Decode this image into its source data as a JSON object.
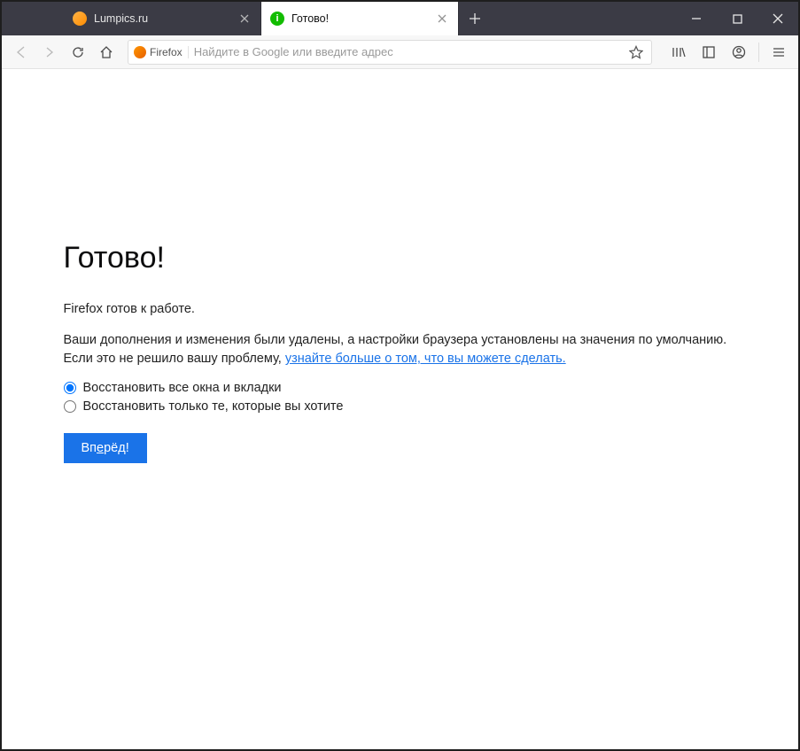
{
  "tabs": [
    {
      "title": "Lumpics.ru",
      "favicon": "lumpics-icon"
    },
    {
      "title": "Готово!",
      "favicon": "info-icon"
    }
  ],
  "urlbar": {
    "identity_label": "Firefox",
    "placeholder": "Найдите в Google или введите адрес"
  },
  "page": {
    "heading": "Готово!",
    "ready_line": "Firefox готов к работе.",
    "details_pre": "Ваши дополнения и изменения были удалены, а настройки браузера установлены на значения по умолчанию. Если это не решило вашу проблему, ",
    "details_link": "узнайте больше о том, что вы можете сделать.",
    "radio_all": "Восстановить все окна и вкладки",
    "radio_some": "Восстановить только те, которые вы хотите",
    "button_pre": "Вп",
    "button_u": "е",
    "button_post": "рёд!"
  }
}
